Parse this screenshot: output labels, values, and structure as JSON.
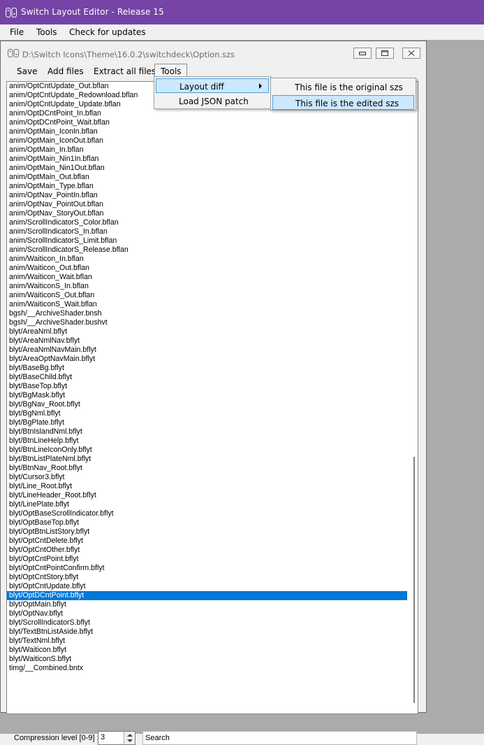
{
  "app": {
    "title": "Switch Layout Editor - Release 15"
  },
  "menubar": {
    "items": [
      "File",
      "Tools",
      "Check for updates"
    ]
  },
  "child": {
    "path": "D:\\Switch Icons\\Theme\\16.0.2\\switchdeck\\Option.szs",
    "toolbar": {
      "save": "Save",
      "add_files": "Add files",
      "extract_all": "Extract all files",
      "tools": "Tools"
    }
  },
  "tools_menu": {
    "items": [
      "Layout diff",
      "Load JSON patch"
    ],
    "layout_diff_submenu": [
      "This file is the original szs",
      "This file is the edited szs"
    ]
  },
  "files": [
    "anim/OptCntUpdate_Out.bflan",
    "anim/OptCntUpdate_Redownload.bflan",
    "anim/OptCntUpdate_Update.bflan",
    "anim/OptDCntPoint_In.bflan",
    "anim/OptDCntPoint_Wait.bflan",
    "anim/OptMain_IconIn.bflan",
    "anim/OptMain_IconOut.bflan",
    "anim/OptMain_In.bflan",
    "anim/OptMain_Nin1In.bflan",
    "anim/OptMain_Nin1Out.bflan",
    "anim/OptMain_Out.bflan",
    "anim/OptMain_Type.bflan",
    "anim/OptNav_PointIn.bflan",
    "anim/OptNav_PointOut.bflan",
    "anim/OptNav_StoryOut.bflan",
    "anim/ScrollIndicatorS_Color.bflan",
    "anim/ScrollIndicatorS_In.bflan",
    "anim/ScrollIndicatorS_Limit.bflan",
    "anim/ScrollIndicatorS_Release.bflan",
    "anim/Waiticon_In.bflan",
    "anim/Waiticon_Out.bflan",
    "anim/Waiticon_Wait.bflan",
    "anim/WaiticonS_In.bflan",
    "anim/WaiticonS_Out.bflan",
    "anim/WaiticonS_Wait.bflan",
    "bgsh/__ArchiveShader.bnsh",
    "bgsh/__ArchiveShader.bushvt",
    "blyt/AreaNml.bflyt",
    "blyt/AreaNmlNav.bflyt",
    "blyt/AreaNmlNavMain.bflyt",
    "blyt/AreaOptNavMain.bflyt",
    "blyt/BaseBg.bflyt",
    "blyt/BaseChild.bflyt",
    "blyt/BaseTop.bflyt",
    "blyt/BgMask.bflyt",
    "blyt/BgNav_Root.bflyt",
    "blyt/BgNml.bflyt",
    "blyt/BgPlate.bflyt",
    "blyt/BtnIslandNml.bflyt",
    "blyt/BtnLineHelp.bflyt",
    "blyt/BtnLineIconOnly.bflyt",
    "blyt/BtnListPlateNml.bflyt",
    "blyt/BtnNav_Root.bflyt",
    "blyt/Cursor3.bflyt",
    "blyt/Line_Root.bflyt",
    "blyt/LineHeader_Root.bflyt",
    "blyt/LinePlate.bflyt",
    "blyt/OptBaseScrollIndicator.bflyt",
    "blyt/OptBaseTop.bflyt",
    "blyt/OptBtnListStory.bflyt",
    "blyt/OptCntDelete.bflyt",
    "blyt/OptCntOther.bflyt",
    "blyt/OptCntPoint.bflyt",
    "blyt/OptCntPointConfirm.bflyt",
    "blyt/OptCntStory.bflyt",
    "blyt/OptCntUpdate.bflyt",
    "blyt/OptDCntPoint.bflyt",
    "blyt/OptMain.bflyt",
    "blyt/OptNav.bflyt",
    "blyt/ScrollIndicatorS.bflyt",
    "blyt/TextBtnListAside.bflyt",
    "blyt/TextNml.bflyt",
    "blyt/Waiticon.bflyt",
    "blyt/WaiticonS.bflyt",
    "timg/__Combined.bntx"
  ],
  "selected_file": "blyt/OptDCntPoint.bflyt",
  "bottom": {
    "compression_label": "Compression level [0-9] :",
    "compression_value": "3",
    "search_placeholder": "Search"
  },
  "colors": {
    "titlebar": "#7544a6",
    "selection": "#0078d7",
    "menu_highlight": "#cce8ff"
  }
}
